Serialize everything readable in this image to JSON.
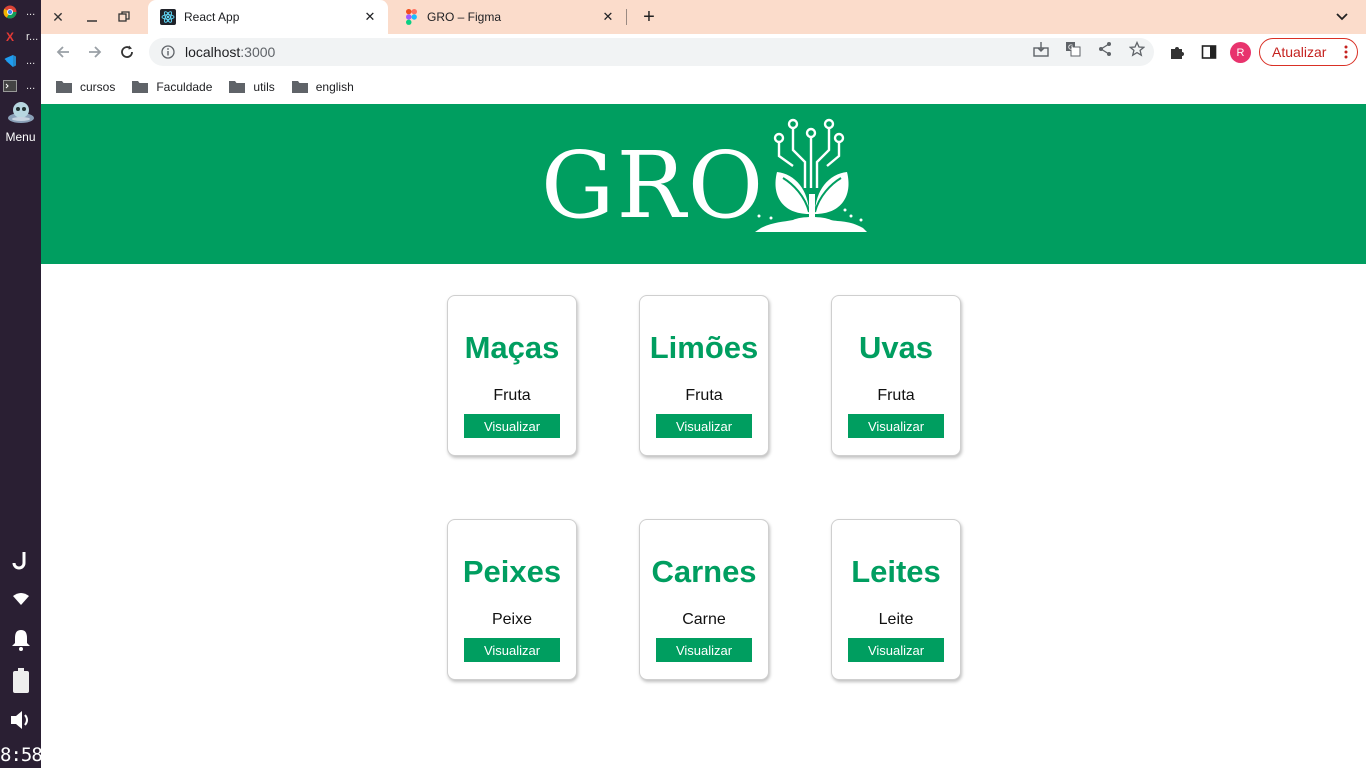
{
  "taskbar": {
    "apps": [
      {
        "icon": "chrome-icon",
        "label": "..."
      },
      {
        "icon": "x-app-icon",
        "label": "r..."
      },
      {
        "icon": "vscode-icon",
        "label": "..."
      },
      {
        "icon": "terminal-icon",
        "label": "..."
      }
    ],
    "menu_label": "Menu",
    "clock": "8:58"
  },
  "browser": {
    "tabs": [
      {
        "title": "React App",
        "icon": "react-icon",
        "active": true
      },
      {
        "title": "GRO – Figma",
        "icon": "figma-icon",
        "active": false
      }
    ],
    "url_host": "localhost",
    "url_port": ":3000",
    "update_label": "Atualizar",
    "avatar_letter": "R",
    "bookmarks": [
      "cursos",
      "Faculdade",
      "utils",
      "english"
    ]
  },
  "page": {
    "brand": "GRO",
    "brand_color": "#009e60",
    "products": [
      {
        "name": "Maças",
        "category": "Fruta",
        "button": "Visualizar"
      },
      {
        "name": "Limões",
        "category": "Fruta",
        "button": "Visualizar"
      },
      {
        "name": "Uvas",
        "category": "Fruta",
        "button": "Visualizar"
      },
      {
        "name": "Peixes",
        "category": "Peixe",
        "button": "Visualizar"
      },
      {
        "name": "Carnes",
        "category": "Carne",
        "button": "Visualizar"
      },
      {
        "name": "Leites",
        "category": "Leite",
        "button": "Visualizar"
      }
    ]
  }
}
